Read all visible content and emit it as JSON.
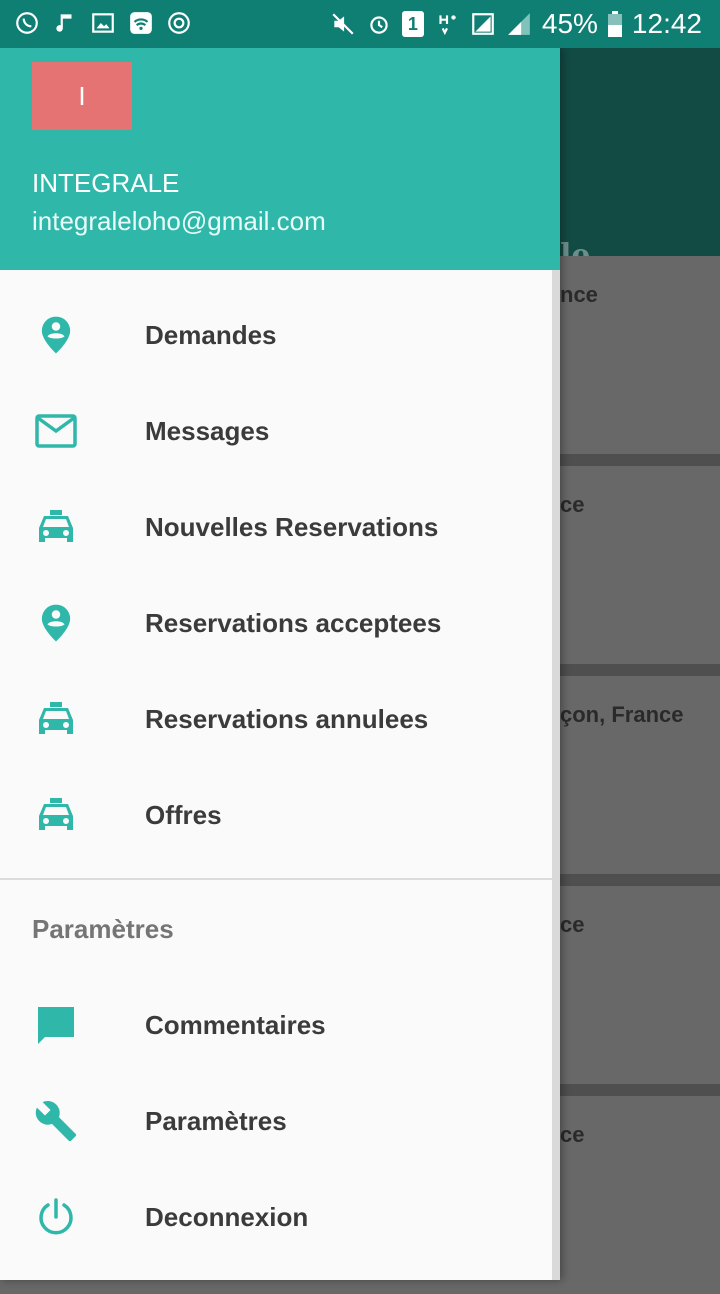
{
  "background": {
    "toolbar_title_fragment": "le",
    "cards": [
      "nce",
      "ce",
      "çon, France",
      "ce",
      "ce"
    ]
  },
  "status_bar": {
    "battery": "45%",
    "time": "12:42",
    "sim_slot": "1"
  },
  "drawer": {
    "avatar_initial": "I",
    "user_name": "INTEGRALE",
    "user_email": "integraleloho@gmail.com",
    "menu": [
      {
        "label": "Demandes",
        "icon": "location-icon"
      },
      {
        "label": "Messages",
        "icon": "mail-icon"
      },
      {
        "label": "Nouvelles Reservations",
        "icon": "taxi-icon"
      },
      {
        "label": "Reservations acceptees",
        "icon": "location-icon"
      },
      {
        "label": "Reservations annulees",
        "icon": "taxi-icon"
      },
      {
        "label": "Offres",
        "icon": "taxi-icon"
      }
    ],
    "section_title": "Paramètres",
    "settings_menu": [
      {
        "label": "Commentaires",
        "icon": "comment-icon"
      },
      {
        "label": "Paramètres",
        "icon": "wrench-icon"
      },
      {
        "label": "Deconnexion",
        "icon": "power-icon"
      }
    ]
  },
  "colors": {
    "accent": "#2fb8aa",
    "avatar": "#e57373",
    "status_bar": "#0f7f74"
  }
}
